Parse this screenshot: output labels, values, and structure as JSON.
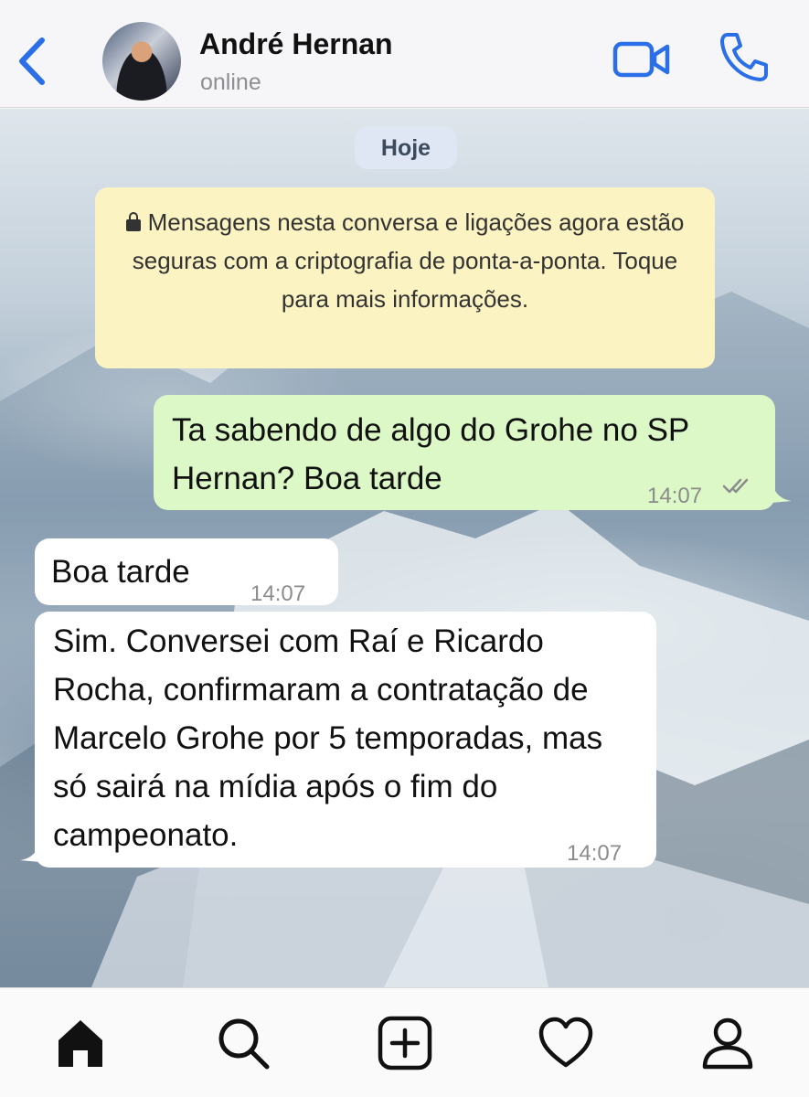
{
  "header": {
    "contact_name": "André Hernan",
    "status": "online",
    "icons": [
      "chevron-left-icon",
      "video-camera-icon",
      "phone-icon"
    ]
  },
  "chat": {
    "date_label": "Hoje",
    "encryption_notice": "Mensagens nesta conversa e ligações agora estão seguras com a criptografia de ponta-a-ponta. Toque para mais informações.",
    "messages": [
      {
        "direction": "outgoing",
        "text": "Ta sabendo de algo do Grohe no SP Hernan? Boa tarde",
        "time": "14:07",
        "status": "read"
      },
      {
        "direction": "incoming",
        "text": "Boa tarde",
        "time": "14:07"
      },
      {
        "direction": "incoming",
        "text": "Sim. Conversei com Raí e Ricardo Rocha, confirmaram a contratação de Marcelo Grohe por 5 temporadas, mas só sairá na mídia após o fim do campeonato.",
        "time": "14:07"
      }
    ]
  },
  "bottom_nav": {
    "items": [
      "home-icon",
      "search-icon",
      "add-post-icon",
      "heart-icon",
      "profile-icon"
    ]
  },
  "colors": {
    "accent": "#2a6fe8",
    "outgoing_bubble": "#dcf8c6",
    "incoming_bubble": "#ffffff",
    "notice_bg": "#fbf3c2"
  }
}
